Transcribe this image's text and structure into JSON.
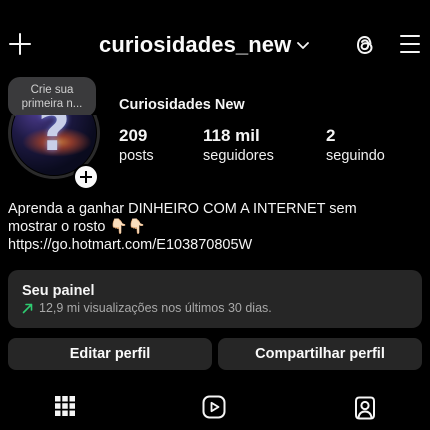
{
  "header": {
    "username": "curiosidades_new",
    "icons": [
      "plus-icon",
      "chevron-down-icon",
      "threads-icon",
      "hamburger-menu-icon"
    ]
  },
  "note": {
    "line1": "Crie sua",
    "line2": "primeira n..."
  },
  "profile": {
    "display_name": "Curiosidades New",
    "stats": [
      {
        "value": "209",
        "label": "posts"
      },
      {
        "value": "118 mil",
        "label": "seguidores"
      },
      {
        "value": "2",
        "label": "seguindo"
      }
    ],
    "bio_line1": "Aprenda a ganhar DINHEIRO COM A INTERNET sem",
    "bio_line2": "mostrar o rosto 👇🏻👇🏻",
    "bio_link": "https://go.hotmart.com/E103870805W"
  },
  "dashboard": {
    "title": "Seu painel",
    "subtitle": "12,9 mi visualizações nos últimos 30 dias.",
    "trend_color": "#2ecc71"
  },
  "actions": {
    "edit_label": "Editar perfil",
    "share_label": "Compartilhar perfil"
  },
  "tabs": [
    "grid-icon",
    "reels-icon",
    "tagged-icon"
  ]
}
